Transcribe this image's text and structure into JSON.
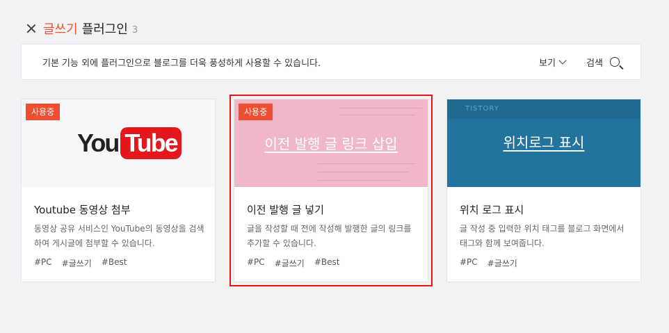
{
  "header": {
    "title_accent": "글쓰기",
    "title_rest": "플러그인",
    "count": "3"
  },
  "infobar": {
    "text": "기본 기능 외에 플러그인으로 블로그를 더욱 풍성하게 사용할 수 있습니다.",
    "view_label": "보기",
    "search_label": "검색"
  },
  "colors": {
    "accent": "#f04e32",
    "highlight": "#e11111",
    "youtube_red": "#e4171d",
    "pink_thumb": "#f0b7c8",
    "blue_thumb": "#22749e"
  },
  "cards": [
    {
      "badge": "사용중",
      "thumb_logo_you": "You",
      "thumb_logo_tube": "Tube",
      "title": "Youtube 동영상 첨부",
      "desc": "동영상 공유 서비스인 YouTube의 동영상을 검색하여 게시글에 첨부할 수 있습니다.",
      "tags": [
        "#PC",
        "#글쓰기",
        "#Best"
      ]
    },
    {
      "badge": "사용중",
      "thumb_text": "이전 발행 글 링크 삽입",
      "title": "이전 발행 글 넣기",
      "desc": "글을 작성할 때 전에 작성해 발행한 글의 링크를 추가할 수 있습니다.",
      "tags": [
        "#PC",
        "#글쓰기",
        "#Best"
      ]
    },
    {
      "thumb_brand": "TISTORY",
      "thumb_text": "위치로그 표시",
      "title": "위치 로그 표시",
      "desc": "글 작성 중 입력한 위치 태그를 블로그 화면에서 태그와 함께 보여줍니다.",
      "tags": [
        "#PC",
        "#글쓰기"
      ]
    }
  ]
}
